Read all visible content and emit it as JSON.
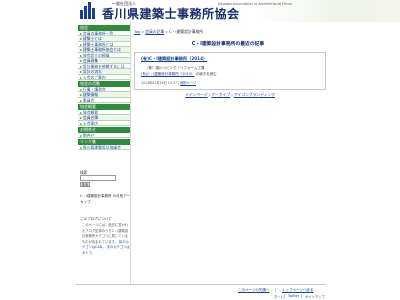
{
  "header": {
    "kicker": "一般社団法人",
    "title": "香川県建築士事務所協会",
    "subtitle": "Kagawa Association of Architectural Firms"
  },
  "sidebar": {
    "sections": [
      {
        "heading": "協会",
        "items": [
          {
            "label": "会員の事務所一覧"
          },
          {
            "label": "建築士とは"
          },
          {
            "label": "建築士事務所とは"
          },
          {
            "label": "建築士事務所協会とは"
          },
          {
            "label": "協会設立の経緯"
          },
          {
            "label": "会員募集"
          },
          {
            "label": "設計業務を依頼するには"
          },
          {
            "label": "設計の流れ"
          },
          {
            "label": "入会のご案内"
          }
        ]
      },
      {
        "heading": "協会の活動",
        "items": [
          {
            "label": "行事・講習会"
          },
          {
            "label": "建築情報"
          },
          {
            "label": "委員会"
          }
        ]
      },
      {
        "heading": "協会概要",
        "items": [
          {
            "label": "協会概要"
          },
          {
            "label": "会員名簿"
          },
          {
            "label": "入会案内"
          }
        ]
      },
      {
        "heading": "お問合せ",
        "items": [
          {
            "label": "問合せ"
          }
        ]
      },
      {
        "heading": "リンク集",
        "items": [
          {
            "label": "香川県建築設計協議会"
          }
        ]
      }
    ],
    "search_label": "検索",
    "search_placeholder": "",
    "search_button": "検索",
    "archive_text": "C・I建築設計事務所 の月別アーカイブ",
    "blog_desc_title": "このブログについて",
    "blog_desc": "このページには、過去に書かれたブログ記事のうちC・I建築設計事務所カテゴリに属しているものが含まれています。",
    "blog_desc_prev": "前のカテゴリはCAD。",
    "blog_desc_next": "次のカテゴリはカトウ。"
  },
  "main": {
    "breadcrumb_home": "Top",
    "breadcrumb_sep1": "»",
    "breadcrumb_members": "会員の記事",
    "breadcrumb_sep2": "»",
    "breadcrumb_current": "C・I建築設計事務所",
    "heading": "C・I建築設計事務所の最近の記事",
    "entry": {
      "title": "(有)C・I建築設計事務所（2014）",
      "line1": "（株）香川リビング「リフォーム工場",
      "line2_link": "(有)C・I建築設計事務所（2014）",
      "line2_rest": "の続きを読む",
      "date": "2014年02月26日 15:37",
      "permalink": "個別ページ"
    },
    "links": [
      "メインページ",
      "アーカイブ",
      "アイコンブランディング"
    ],
    "links_sep": "|"
  },
  "footer": {
    "page_top": "このページの先頭へ",
    "sep": "|",
    "top_page": "トップページへ戻る",
    "small_links": [
      "ホーム",
      "Twitter",
      "サイトマップ"
    ]
  },
  "colors": {
    "nav_heading": "#2e8c3c",
    "link": "#1a3f8f",
    "title": "#1a2d6b"
  }
}
